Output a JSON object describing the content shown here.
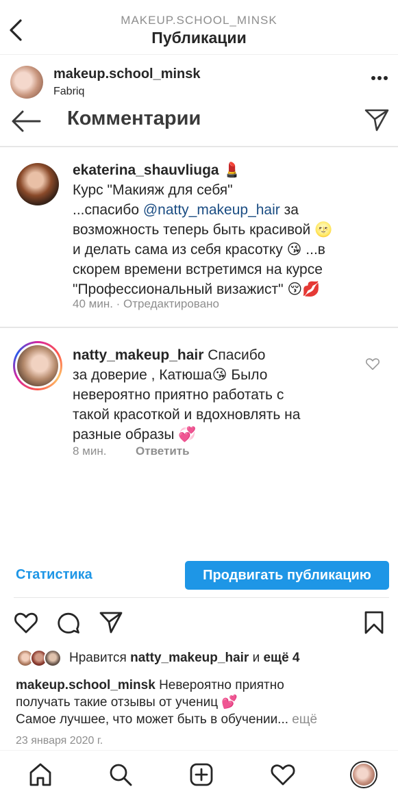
{
  "header": {
    "account_caps": "MAKEUP.SCHOOL_MINSK",
    "title": "Публикации"
  },
  "post": {
    "username": "makeup.school_minsk",
    "location": "Fabriq"
  },
  "comments_screen": {
    "title": "Комментарии",
    "comments": [
      {
        "username": "ekaterina_shauvliuga",
        "username_emoji": "💄",
        "line1": "Курс \"Макияж для себя\"",
        "line2_pre": "...спасибо ",
        "mention": "@natty_makeup_hair",
        "line2_post": "  за",
        "line3": "возможность теперь быть красивой 🌝",
        "line4": "и делать сама из себя красотку 😘 ...в",
        "line5": "скорем времени встретимся на курсе",
        "line6": "\"Профессиональный визажист\" 😚💋",
        "time": "40 мин.",
        "edited": " · Отредактировано"
      },
      {
        "username": "natty_makeup_hair",
        "text_first": " Спасибо",
        "line2": "за доверие , Катюша😘 Было",
        "line3": "невероятно приятно работать с",
        "line4": "такой красоткой и вдохновлять на",
        "line5": "разные образы 💞",
        "time": "8 мин.",
        "reply": "Ответить"
      }
    ]
  },
  "stats_link": "Статистика",
  "promote_button": "Продвигать публикацию",
  "likes": {
    "prefix": "Нравится ",
    "user": "natty_makeup_hair",
    "middle": " и ",
    "count": "ещё 4"
  },
  "caption": {
    "username": "makeup.school_minsk",
    "line1": " Невероятно приятно",
    "line2": "получать такие отзывы от учениц 💕",
    "line3": "Самое лучшее, что может быть в обучении...",
    "more": " ещё"
  },
  "date": "23 января 2020 г.",
  "icons": {
    "back": "chevron-left-icon",
    "more": "more-horizontal-icon",
    "like": "heart-icon",
    "comment": "comment-icon",
    "share": "send-icon",
    "save": "bookmark-icon",
    "nav": [
      "home-icon",
      "search-icon",
      "add-icon",
      "heart-icon",
      "profile-avatar"
    ]
  },
  "colors": {
    "accent": "#1e96e6",
    "text": "#262626",
    "muted": "#8e8e8e",
    "mention": "#1a4c82"
  }
}
